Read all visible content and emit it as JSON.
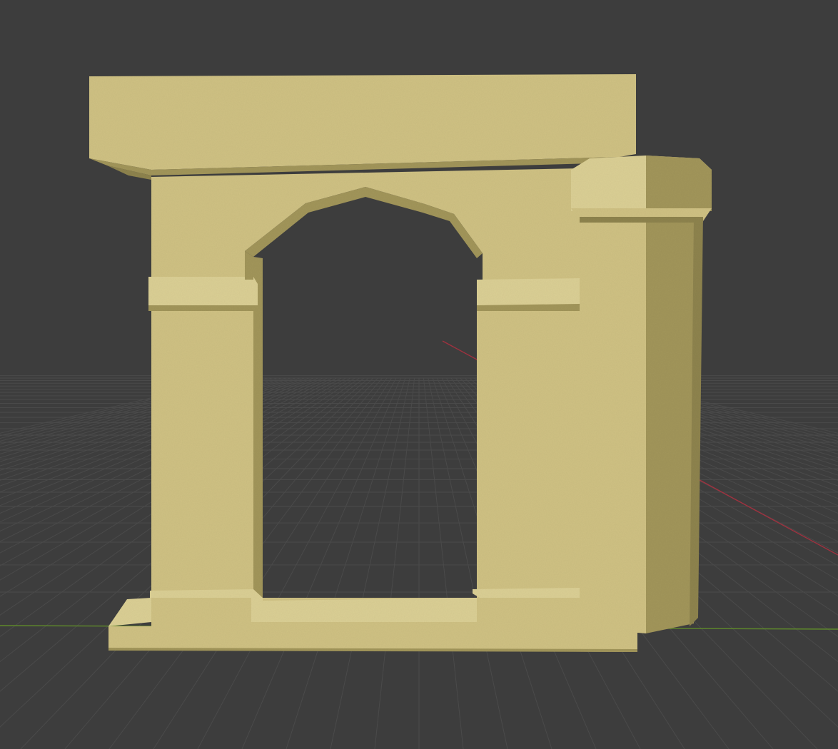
{
  "viewport": {
    "background_color": "#3d3d3d",
    "grid_line_color": "#4a4a4a",
    "x_axis_color": "#a0313f",
    "y_axis_color": "#5f8a2a"
  },
  "model": {
    "object": "stone-archway",
    "stone_color": "#d0c284",
    "stone_light_color": "#dcd095",
    "stone_shadow_color": "#a3965c",
    "stone_dark_color": "#8f8450"
  }
}
